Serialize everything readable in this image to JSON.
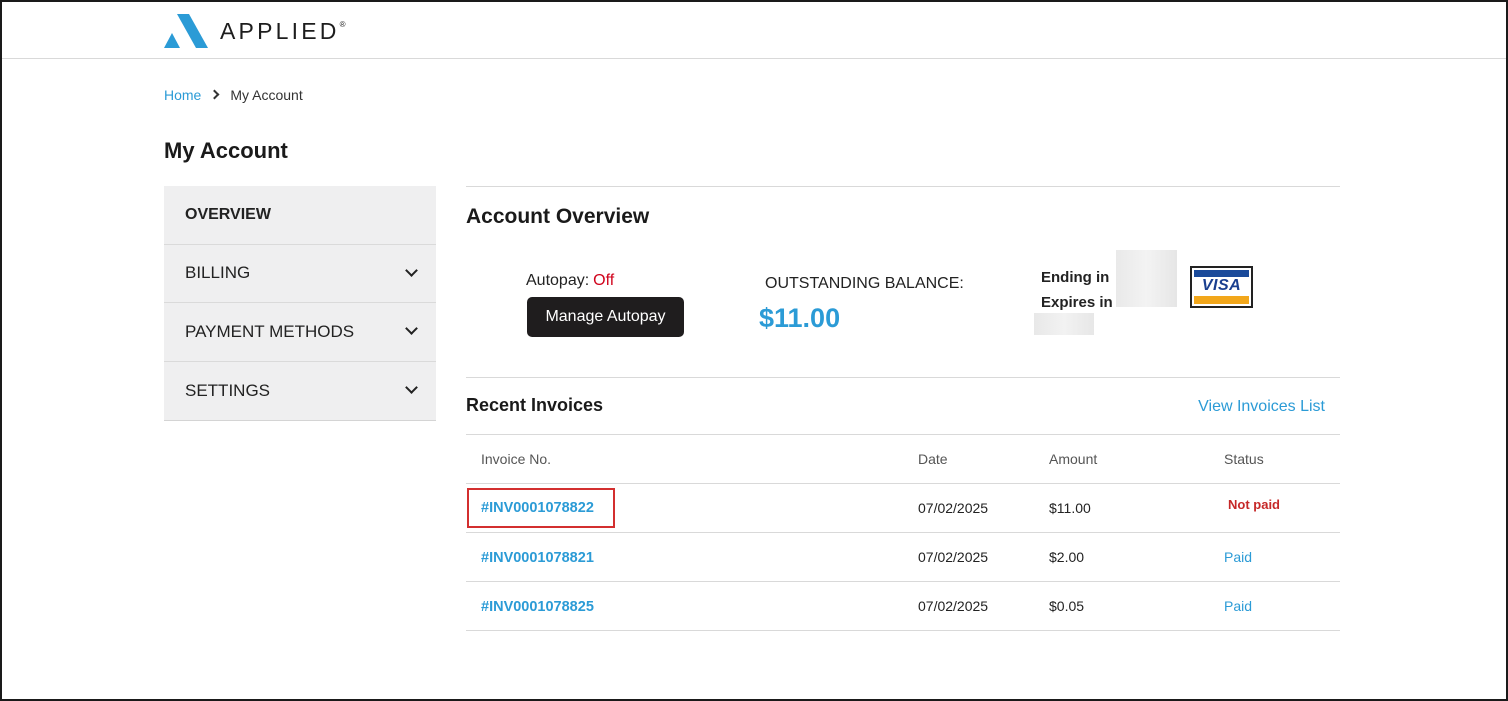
{
  "header": {
    "logo_text": "APPLIED",
    "logo_mark": "®"
  },
  "breadcrumb": {
    "home": "Home",
    "current": "My Account"
  },
  "page_title": "My Account",
  "sidebar": {
    "items": [
      {
        "label": "OVERVIEW",
        "active": true
      },
      {
        "label": "BILLING",
        "expandable": true
      },
      {
        "label": "PAYMENT METHODS",
        "expandable": true
      },
      {
        "label": "SETTINGS",
        "expandable": true
      }
    ]
  },
  "overview": {
    "title": "Account Overview",
    "autopay_label": "Autopay:",
    "autopay_status": "Off",
    "manage_autopay_button": "Manage Autopay",
    "balance_label": "OUTSTANDING BALANCE:",
    "balance_amount": "$11.00",
    "card_ending_label": "Ending in",
    "card_expires_label": "Expires in",
    "card_brand": "VISA"
  },
  "recent_invoices": {
    "title": "Recent Invoices",
    "view_list_link": "View Invoices List",
    "columns": [
      "Invoice No.",
      "Date",
      "Amount",
      "Status"
    ],
    "rows": [
      {
        "invoice": "#INV0001078822",
        "date": "07/02/2025",
        "amount": "$11.00",
        "status": "Not paid"
      },
      {
        "invoice": "#INV0001078821",
        "date": "07/02/2025",
        "amount": "$2.00",
        "status": "Paid"
      },
      {
        "invoice": "#INV0001078825",
        "date": "07/02/2025",
        "amount": "$0.05",
        "status": "Paid"
      }
    ]
  },
  "colors": {
    "accent": "#2b9bd6",
    "danger": "#d0021b",
    "button_dark": "#1f1d1e"
  }
}
